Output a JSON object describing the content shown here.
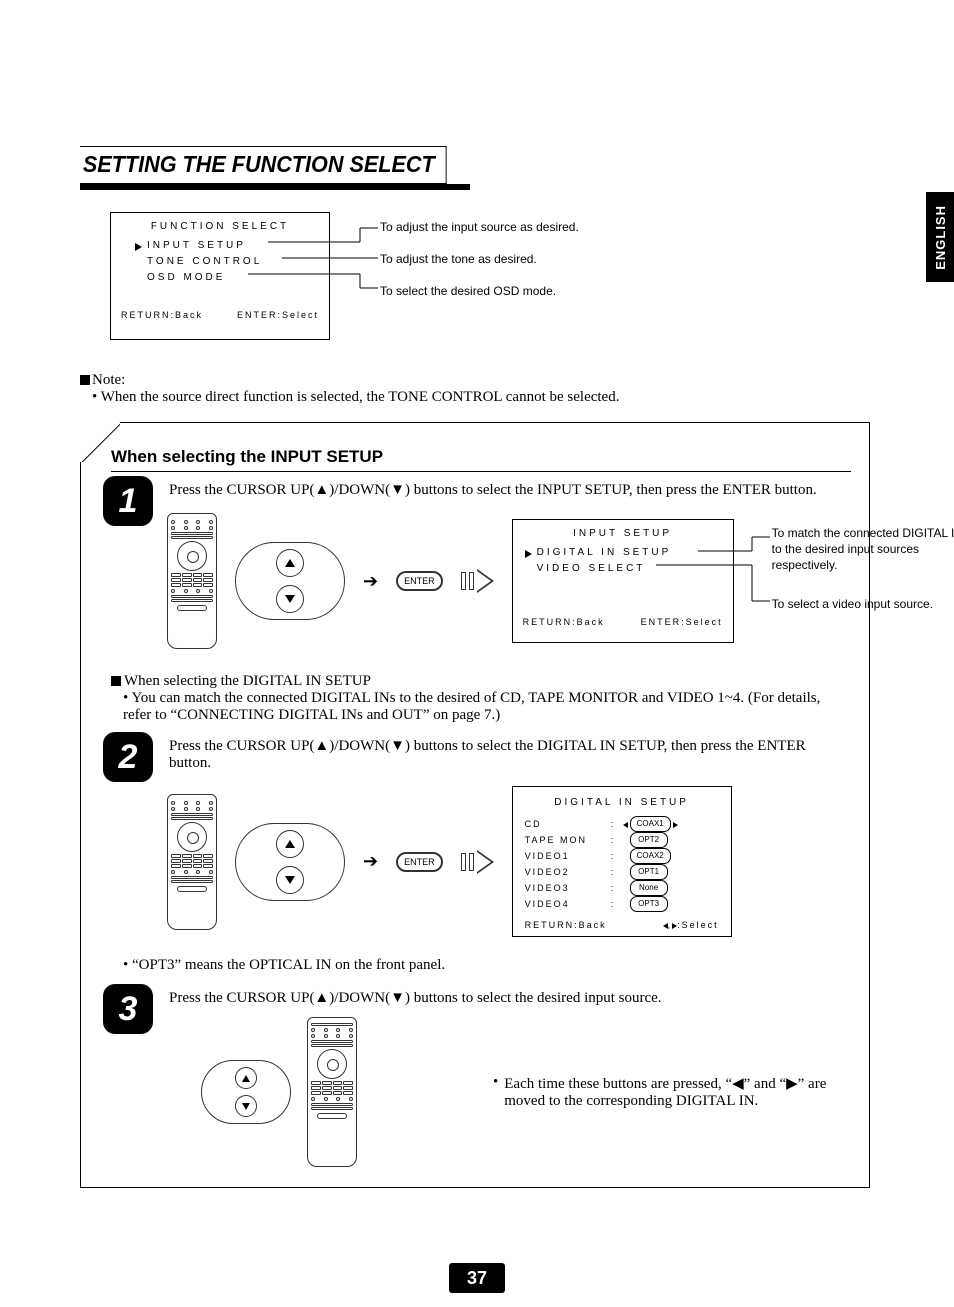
{
  "language_tab": "ENGLISH",
  "title": "SETTING THE FUNCTION SELECT",
  "osd_function_select": {
    "title": "FUNCTION SELECT",
    "items": [
      "INPUT SETUP",
      "TONE CONTROL",
      "OSD MODE"
    ],
    "cursor_index": 0,
    "foot_left": "RETURN:Back",
    "foot_right": "ENTER:Select",
    "callouts": [
      "To adjust the input source as desired.",
      "To adjust the tone as desired.",
      "To select the desired OSD mode."
    ]
  },
  "note": {
    "label": "Note:",
    "bullet": "When the source direct function is selected, the TONE CONTROL cannot be selected."
  },
  "proc": {
    "heading": "When selecting the INPUT SETUP",
    "step1": {
      "num": "1",
      "text": "Press the CURSOR UP(▲)/DOWN(▼) buttons to select the INPUT SETUP, then press the ENTER button.",
      "enter_label": "ENTER",
      "osd": {
        "title": "INPUT SETUP",
        "items": [
          "DIGITAL IN SETUP",
          "VIDEO SELECT"
        ],
        "cursor_index": 0,
        "foot_left": "RETURN:Back",
        "foot_right": "ENTER:Select",
        "callouts": [
          "To match the connected DIGITAL INs to the desired input sources respectively.",
          "To select a video input source."
        ]
      }
    },
    "sub_digin": {
      "heading": "When selecting the DIGITAL IN SETUP",
      "bullet": "You can match the connected DIGITAL INs to the desired of CD, TAPE MONITOR and VIDEO 1~4. (For details, refer to “CONNECTING DIGITAL INs and OUT” on page 7.)"
    },
    "step2": {
      "num": "2",
      "text": "Press the CURSOR UP(▲)/DOWN(▼) buttons to select the DIGITAL IN SETUP, then press the ENTER button.",
      "enter_label": "ENTER",
      "din": {
        "title": "DIGITAL IN SETUP",
        "rows": [
          {
            "k": "CD",
            "v": "COAX1",
            "sel": true
          },
          {
            "k": "TAPE MON",
            "v": "OPT2",
            "sel": false
          },
          {
            "k": "VIDEO1",
            "v": "COAX2",
            "sel": false
          },
          {
            "k": "VIDEO2",
            "v": "OPT1",
            "sel": false
          },
          {
            "k": "VIDEO3",
            "v": "None",
            "sel": false
          },
          {
            "k": "VIDEO4",
            "v": "OPT3",
            "sel": false
          }
        ],
        "foot_left": "RETURN:Back",
        "foot_right_label": ":Select"
      }
    },
    "opt3_note": "“OPT3” means the OPTICAL IN on the front panel.",
    "step3": {
      "num": "3",
      "text": "Press the CURSOR UP(▲)/DOWN(▼) buttons to select the desired input source.",
      "side_note": "Each time these buttons are pressed, “◀” and “▶” are moved to the corresponding DIGITAL IN."
    }
  },
  "page_number": "37"
}
